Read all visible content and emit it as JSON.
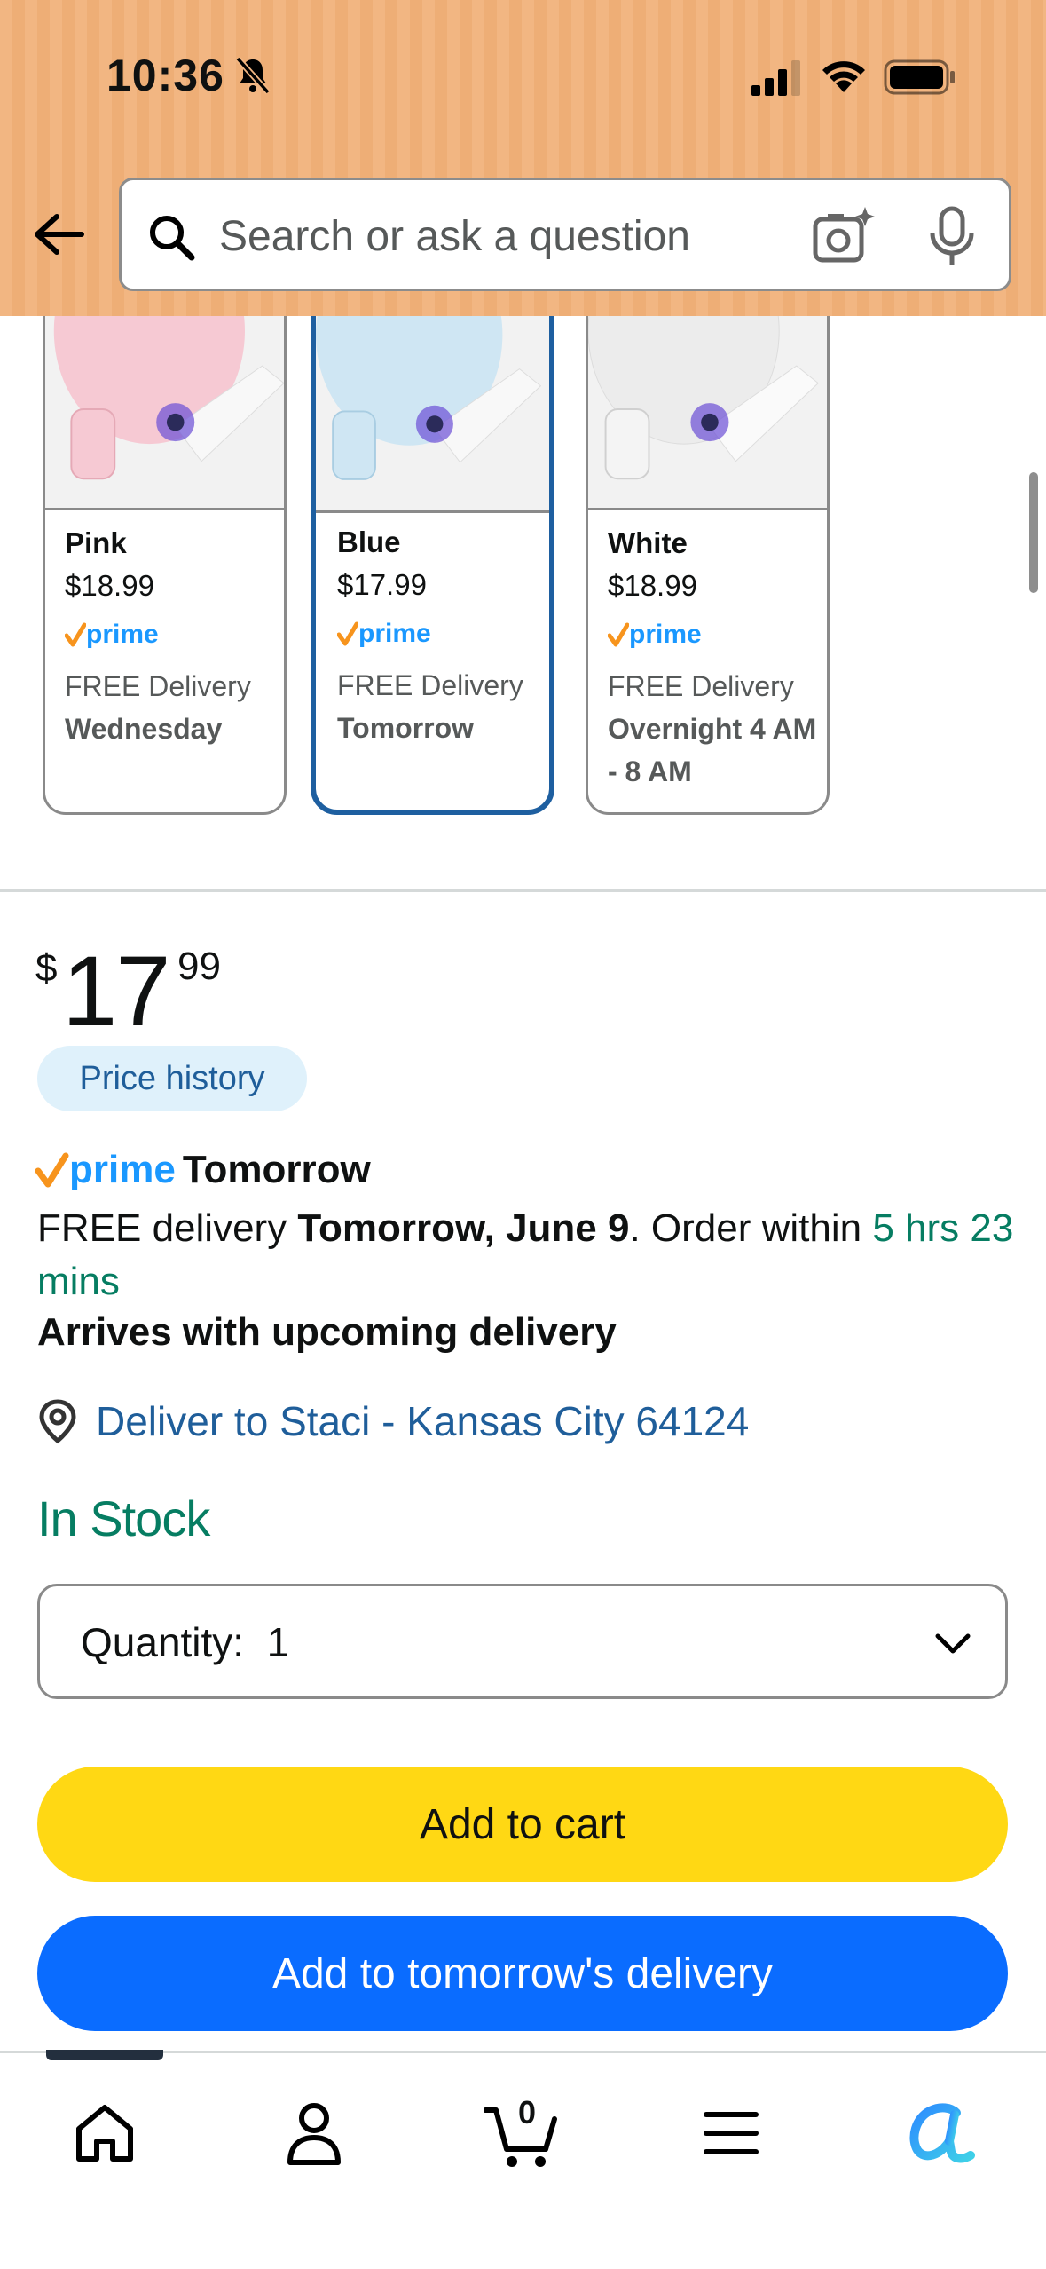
{
  "status_bar": {
    "time": "10:36"
  },
  "search": {
    "placeholder": "Search or ask a question"
  },
  "variants": [
    {
      "color": "Pink",
      "price": "$18.99",
      "prime": "prime",
      "delivery": "FREE Delivery",
      "when": "Wednesday",
      "swatch": "#f6c9d3"
    },
    {
      "color": "Blue",
      "price": "$17.99",
      "prime": "prime",
      "delivery": "FREE Delivery",
      "when": "Tomorrow",
      "swatch": "#cfe6f3"
    },
    {
      "color": "White",
      "price": "$18.99",
      "prime": "prime",
      "delivery": "FREE Delivery",
      "when": "Overnight 4 AM - 8 AM",
      "swatch": "#ececec"
    }
  ],
  "price": {
    "symbol": "$",
    "whole": "17",
    "fraction": "99"
  },
  "price_history": "Price history",
  "prime_delivery": {
    "badge": "prime",
    "when": "Tomorrow"
  },
  "delivery": {
    "prefix": "FREE delivery ",
    "date": "Tomorrow, June 9",
    "mid": ". Order within ",
    "countdown": "5 hrs 23 mins",
    "arrives": "Arrives with upcoming delivery"
  },
  "location": "Deliver to Staci - Kansas City 64124",
  "stock": "In Stock",
  "quantity": {
    "label": "Quantity:",
    "value": "1"
  },
  "buttons": {
    "add_to_cart": "Add to cart",
    "add_tomorrow": "Add to tomorrow's delivery"
  },
  "cart_count": "0",
  "colors": {
    "prime_blue": "#1a98ff",
    "prime_check": "#f7941d",
    "cart_button": "#ffd814",
    "tomorrow_button": "#0a6cff",
    "in_stock": "#067d62",
    "link": "#1f5e9a",
    "header_bg": "#f2b682"
  }
}
